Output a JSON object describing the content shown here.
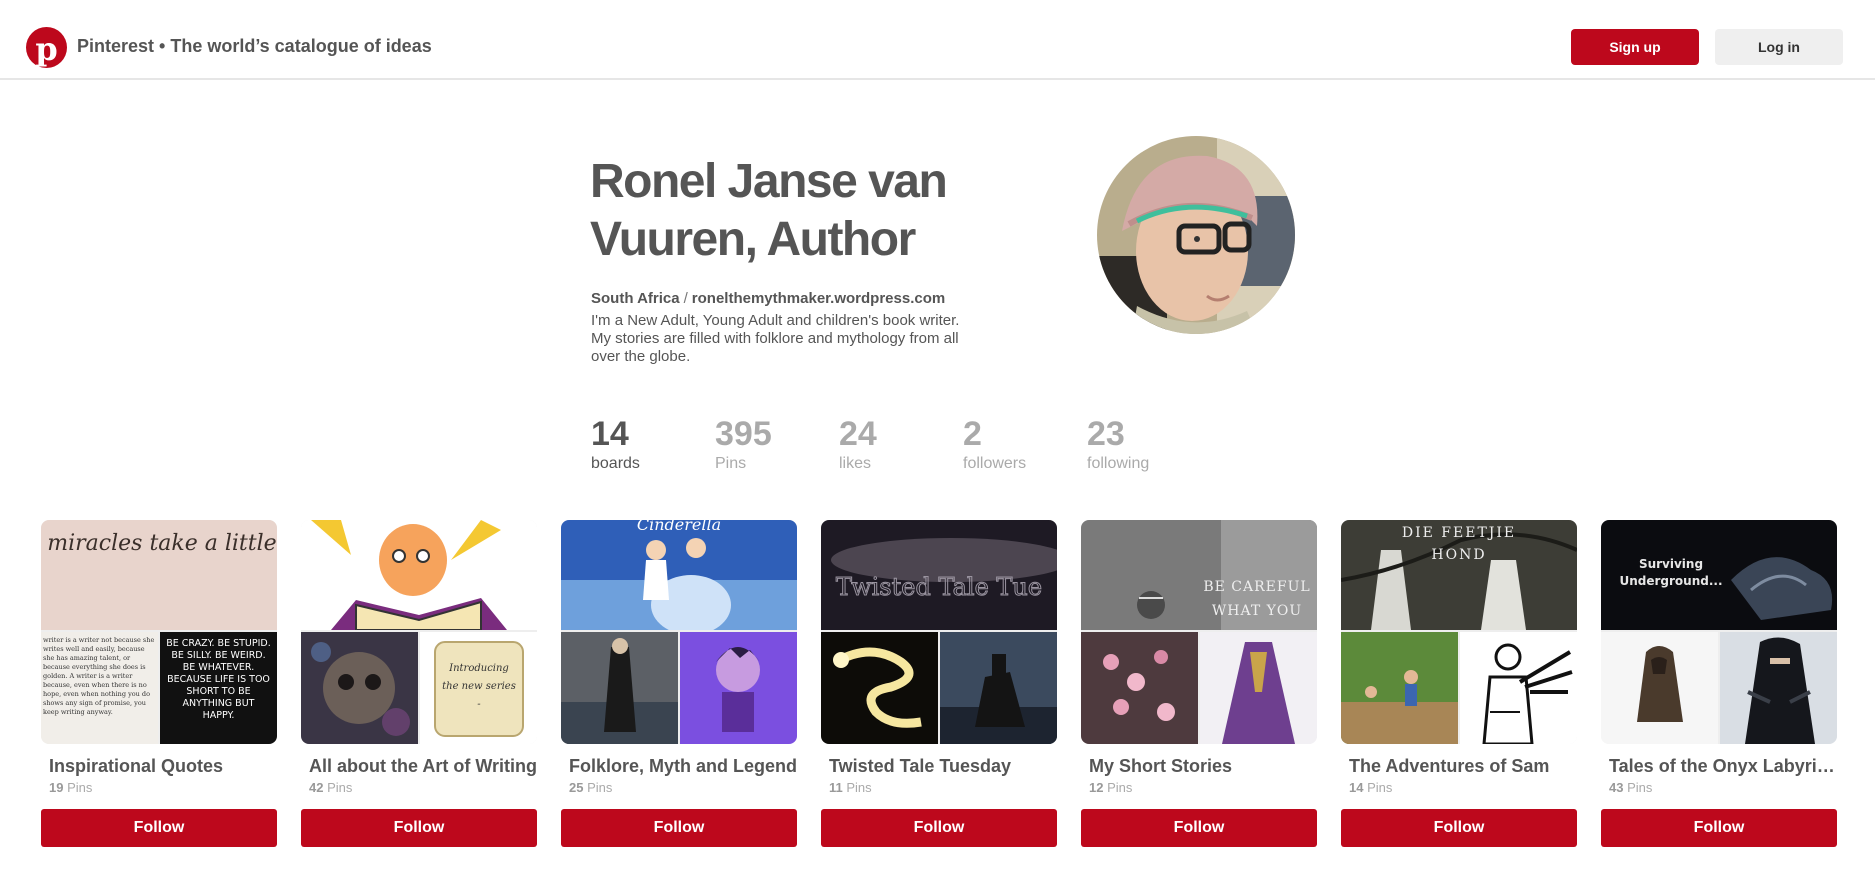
{
  "header": {
    "title": "Pinterest • The world’s catalogue of ideas",
    "logo_letter": "p",
    "signup_label": "Sign up",
    "login_label": "Log in"
  },
  "profile": {
    "name": "Ronel Janse van Vuuren, Author",
    "location": "South Africa",
    "separator": "/",
    "website": "ronelthemythmaker.wordpress.com",
    "bio": "I'm a New Adult, Young Adult and children's book writer. My stories are filled with folklore and mythology from all over the globe."
  },
  "stats": [
    {
      "value": "14",
      "label": "boards"
    },
    {
      "value": "395",
      "label": "Pins"
    },
    {
      "value": "24",
      "label": "likes"
    },
    {
      "value": "2",
      "label": "followers"
    },
    {
      "value": "23",
      "label": "following"
    }
  ],
  "boards": [
    {
      "title": "Inspirational Quotes",
      "pins_count": "19",
      "pins_label": "Pins",
      "follow_label": "Follow",
      "cover_text": {
        "top": "Even miracles take a little time",
        "left": "writer is a writer not because she writes well and easily, because she has amazing talent, or because everything she does is golden. A writer is a writer because, even when there is no hope, even when nothing you do shows any sign of promise, you keep writing anyway.",
        "right": "BE CRAZY. BE STUPID. BE SILLY. BE WEIRD. BE WHATEVER. BECAUSE LIFE IS TOO SHORT TO BE ANYTHING BUT HAPPY."
      }
    },
    {
      "title": "All about the Art of Writing",
      "pins_count": "42",
      "pins_label": "Pins",
      "follow_label": "Follow",
      "cover_text": {
        "right": "Introducing the new series -"
      }
    },
    {
      "title": "Folklore, Myth and Legend",
      "pins_count": "25",
      "pins_label": "Pins",
      "follow_label": "Follow",
      "cover_text": {
        "top": "Cinderella"
      }
    },
    {
      "title": "Twisted Tale Tuesday",
      "pins_count": "11",
      "pins_label": "Pins",
      "follow_label": "Follow",
      "cover_text": {
        "top": "Twisted Tale Tue"
      }
    },
    {
      "title": "My Short Stories",
      "pins_count": "12",
      "pins_label": "Pins",
      "follow_label": "Follow",
      "cover_text": {
        "top": "BE CAREFUL WHAT YOU"
      }
    },
    {
      "title": "The Adventures of Sam",
      "pins_count": "14",
      "pins_label": "Pins",
      "follow_label": "Follow",
      "cover_text": {
        "top": "DIE FEETJIE HOND"
      }
    },
    {
      "title": "Tales of the Onyx Labyrinth",
      "pins_count": "43",
      "pins_label": "Pins",
      "follow_label": "Follow",
      "cover_text": {
        "top": "Surviving Underground..."
      }
    }
  ],
  "colors": {
    "brand_red": "#bd081c",
    "text_dark": "#555555",
    "text_muted": "#aaaaaa",
    "login_bg": "#efefef"
  },
  "icons": {
    "logo": "pinterest-logo-icon"
  }
}
